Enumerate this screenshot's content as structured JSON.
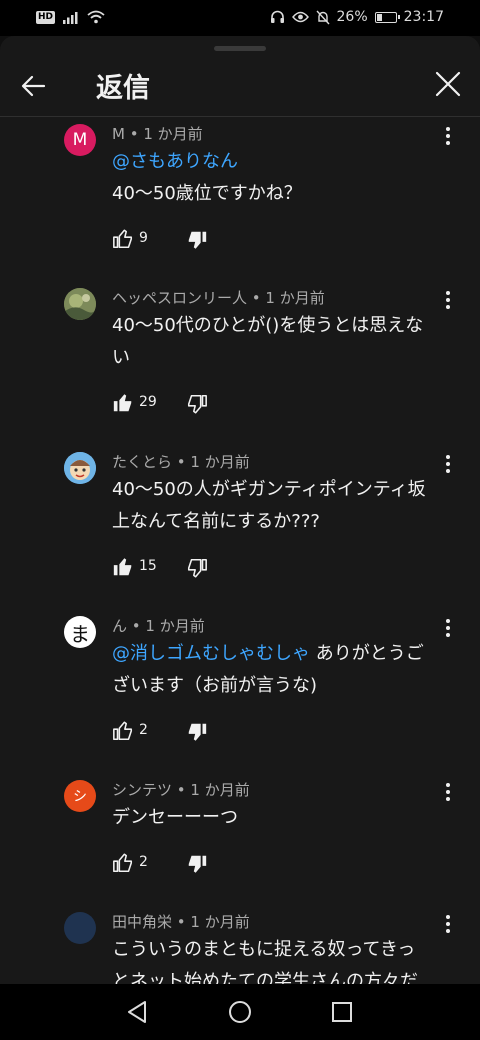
{
  "status": {
    "battery": "26%",
    "time": "23:17",
    "hd": "HD"
  },
  "header": {
    "title": "返信"
  },
  "comments": [
    {
      "avatar_letter": "M",
      "avatar_color": "#d81b60",
      "avatar_kind": "letter",
      "meta": "M • 1 か月前",
      "mention": "@さもありなん",
      "lines": [
        "40〜50歳位ですかね？"
      ],
      "likes": "9",
      "liked": false
    },
    {
      "avatar_letter": "",
      "avatar_color": "#6b7a4a",
      "avatar_kind": "photo",
      "meta": "ヘッペスロンリー人 • 1 か月前",
      "mention": "",
      "lines": [
        "40〜50代のひとが()を使うとは思えな",
        "い"
      ],
      "likes": "29",
      "liked": true
    },
    {
      "avatar_letter": "",
      "avatar_color": "#5aa0d8",
      "avatar_kind": "cartoon",
      "meta": "たくとら • 1 か月前",
      "mention": "",
      "lines": [
        "40〜50の人がギガンティポインティ坂",
        "上なんて名前にするか???"
      ],
      "likes": "15",
      "liked": true
    },
    {
      "avatar_letter": "ま",
      "avatar_color": "#ffffff",
      "avatar_kind": "letter-dark",
      "meta": "ん • 1 か月前",
      "mention": "@消しゴムむしゃむしゃ",
      "mention_suffix": " ありがとうご",
      "lines": [
        "ざいます（お前が言うな)"
      ],
      "likes": "2",
      "liked": false
    },
    {
      "avatar_letter": "シ",
      "avatar_color": "#e64a19",
      "avatar_kind": "letter",
      "meta": "シンテツ • 1 か月前",
      "mention": "",
      "lines": [
        "デンセーーーつ"
      ],
      "likes": "2",
      "liked": false
    },
    {
      "avatar_letter": "",
      "avatar_color": "#1f3350",
      "avatar_kind": "dark",
      "meta": "田中角栄 • 1 か月前",
      "mention": "",
      "lines": [
        "こういうのまともに捉える奴ってきっ",
        "とネット始めたての学生さんの方々だ"
      ],
      "likes": "",
      "liked": false
    }
  ],
  "icons": {
    "back": "arrow-left-icon",
    "close": "close-icon",
    "like": "thumb-up-icon",
    "dislike": "thumb-down-icon",
    "more": "more-vert-icon",
    "nav_back": "triangle-back-icon",
    "nav_home": "circle-home-icon",
    "nav_recent": "square-recent-icon"
  }
}
